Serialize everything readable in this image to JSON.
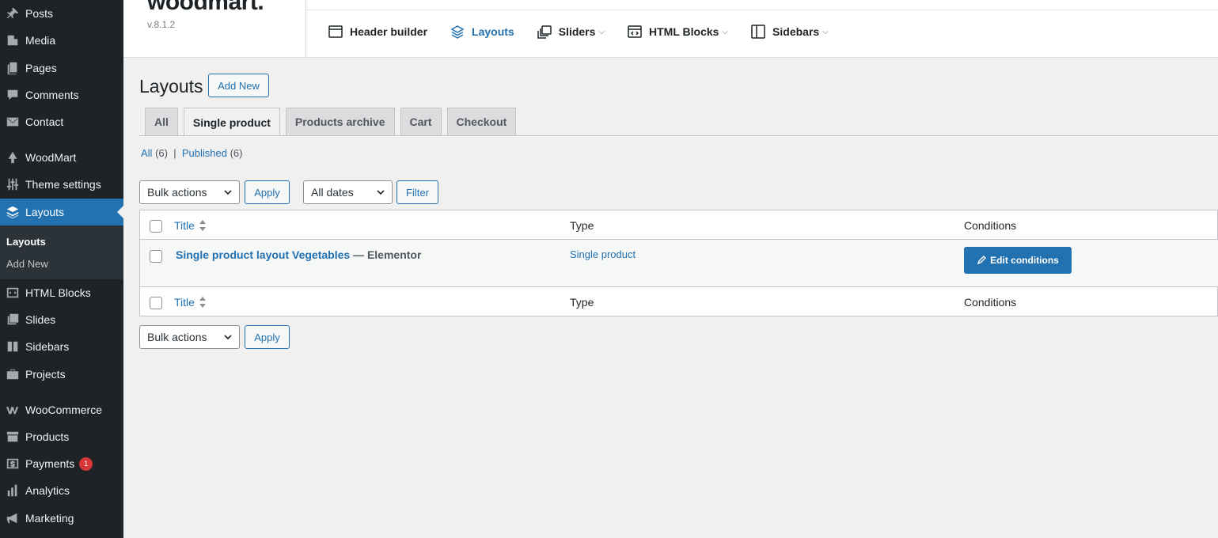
{
  "sidebar": {
    "items": [
      {
        "label": "Posts",
        "icon": "pin-icon"
      },
      {
        "label": "Media",
        "icon": "media-icon"
      },
      {
        "label": "Pages",
        "icon": "pages-icon"
      },
      {
        "label": "Comments",
        "icon": "comment-icon"
      },
      {
        "label": "Contact",
        "icon": "mail-icon"
      },
      {
        "label": "WoodMart",
        "icon": "tree-icon"
      },
      {
        "label": "Theme settings",
        "icon": "sliders-icon"
      },
      {
        "label": "Layouts",
        "icon": "layers-icon"
      },
      {
        "label": "HTML Blocks",
        "icon": "code-block-icon"
      },
      {
        "label": "Slides",
        "icon": "slides-icon"
      },
      {
        "label": "Sidebars",
        "icon": "sidebar-icon"
      },
      {
        "label": "Projects",
        "icon": "briefcase-icon"
      },
      {
        "label": "WooCommerce",
        "icon": "woo-icon"
      },
      {
        "label": "Products",
        "icon": "archive-icon"
      },
      {
        "label": "Payments",
        "icon": "dollar-icon",
        "badge": "1"
      },
      {
        "label": "Analytics",
        "icon": "bar-chart-icon"
      },
      {
        "label": "Marketing",
        "icon": "megaphone-icon"
      }
    ],
    "submenu": {
      "current": "Layouts",
      "add_new": "Add New"
    }
  },
  "brand": {
    "logo_text": "woodmart.",
    "version": "v.8.1.2"
  },
  "topnav": {
    "header_builder": "Header builder",
    "layouts": "Layouts",
    "sliders": "Sliders",
    "html_blocks": "HTML Blocks",
    "sidebars": "Sidebars",
    "chevron": "⌵"
  },
  "page": {
    "title": "Layouts",
    "add_new": "Add New",
    "tabs": [
      "All",
      "Single product",
      "Products archive",
      "Cart",
      "Checkout"
    ],
    "filters": {
      "all_label": "All",
      "all_count": "(6)",
      "separator": "|",
      "published_label": "Published",
      "published_count": "(6)"
    },
    "bulk_actions": "Bulk actions",
    "apply": "Apply",
    "all_dates": "All dates",
    "filter": "Filter"
  },
  "table": {
    "columns": {
      "title": "Title",
      "type": "Type",
      "conditions": "Conditions"
    },
    "rows": [
      {
        "title": "Single product layout Vegetables",
        "suffix": " — Elementor",
        "type": "Single product",
        "action": "Edit conditions"
      }
    ]
  },
  "colors": {
    "accent": "#2271b1",
    "sidebar_bg": "#1d2327",
    "badge": "#d63638"
  }
}
